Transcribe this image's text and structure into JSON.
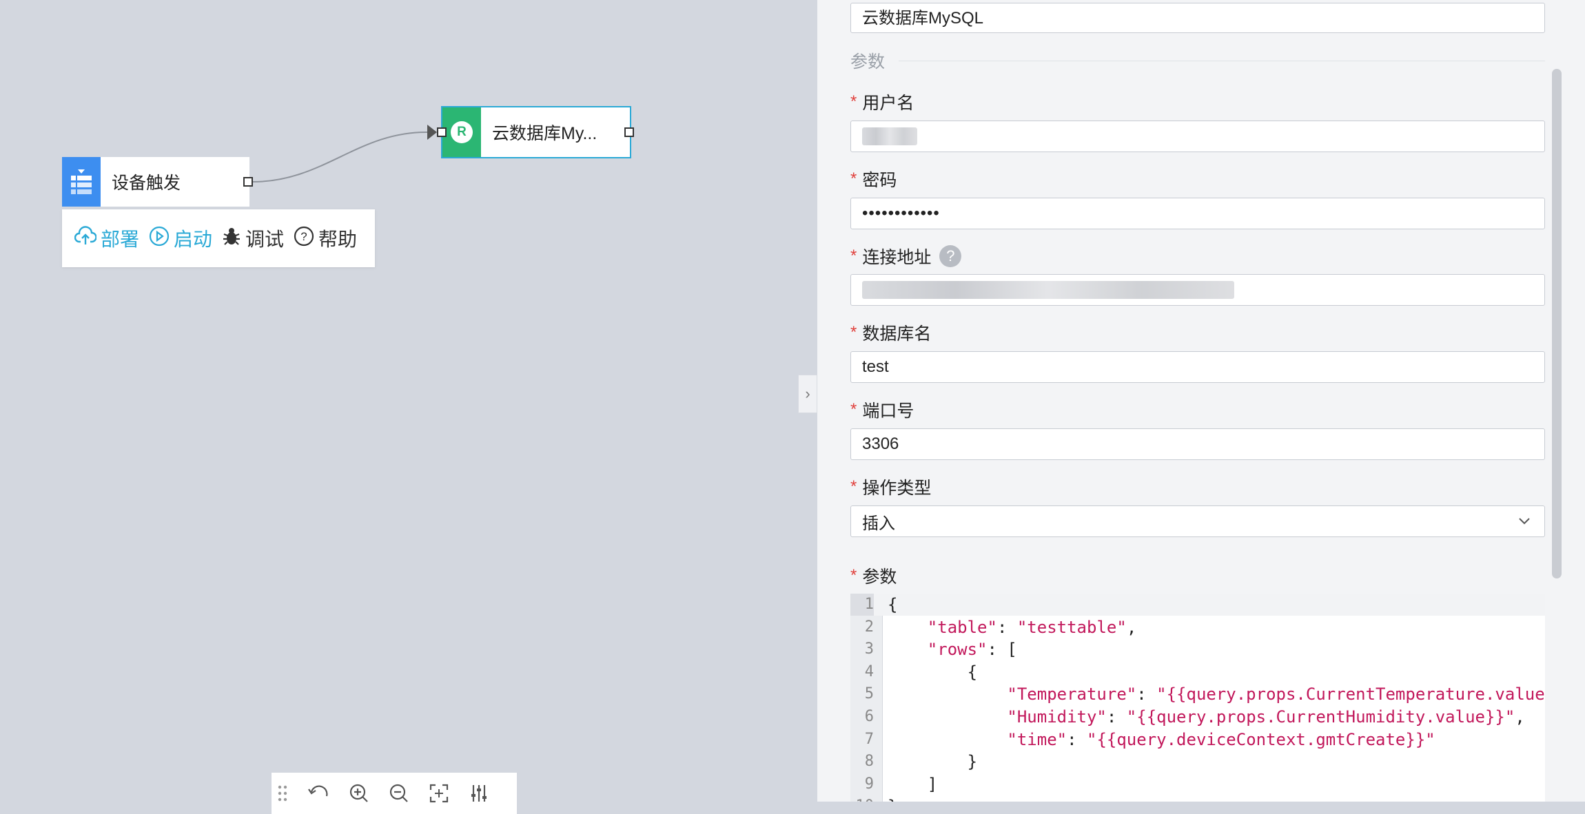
{
  "canvas": {
    "nodes": {
      "trigger": {
        "label": "设备触发",
        "icon": "device-trigger-icon",
        "color": "#3d8ef0"
      },
      "mysql": {
        "label": "云数据库My...",
        "badge": "R",
        "icon": "rds-icon",
        "color": "#2bb673"
      }
    },
    "toolbar": {
      "deploy": "部署",
      "start": "启动",
      "debug": "调试",
      "help": "帮助"
    },
    "zoom_tools": [
      "drag-handle-icon",
      "undo-icon",
      "zoom-in-icon",
      "zoom-out-icon",
      "fit-view-icon",
      "settings-sliders-icon"
    ],
    "collapse_glyph": "›"
  },
  "panel": {
    "node_name_value": "云数据库MySQL",
    "section_title": "参数",
    "fields": {
      "username": {
        "label": "用户名",
        "value": ""
      },
      "password": {
        "label": "密码",
        "value": "••••••••••••"
      },
      "host": {
        "label": "连接地址",
        "value": "",
        "help": "?"
      },
      "database": {
        "label": "数据库名",
        "value": "test"
      },
      "port": {
        "label": "端口号",
        "value": "3306"
      },
      "operation": {
        "label": "操作类型",
        "value": "插入"
      },
      "params": {
        "label": "参数"
      }
    },
    "editor": {
      "lines": [
        {
          "n": "1",
          "parts": [
            {
              "t": "{",
              "c": "p"
            }
          ]
        },
        {
          "n": "2",
          "parts": [
            {
              "t": "    ",
              "c": "p"
            },
            {
              "t": "\"table\"",
              "c": "s"
            },
            {
              "t": ": ",
              "c": "p"
            },
            {
              "t": "\"testtable\"",
              "c": "s"
            },
            {
              "t": ",",
              "c": "p"
            }
          ]
        },
        {
          "n": "3",
          "parts": [
            {
              "t": "    ",
              "c": "p"
            },
            {
              "t": "\"rows\"",
              "c": "s"
            },
            {
              "t": ": [",
              "c": "p"
            }
          ]
        },
        {
          "n": "4",
          "parts": [
            {
              "t": "        {",
              "c": "p"
            }
          ]
        },
        {
          "n": "5",
          "parts": [
            {
              "t": "            ",
              "c": "p"
            },
            {
              "t": "\"Temperature\"",
              "c": "s"
            },
            {
              "t": ": ",
              "c": "p"
            },
            {
              "t": "\"{{query.props.CurrentTemperature.value}}\"",
              "c": "s"
            },
            {
              "t": ",",
              "c": "p"
            }
          ]
        },
        {
          "n": "6",
          "parts": [
            {
              "t": "            ",
              "c": "p"
            },
            {
              "t": "\"Humidity\"",
              "c": "s"
            },
            {
              "t": ": ",
              "c": "p"
            },
            {
              "t": "\"{{query.props.CurrentHumidity.value}}\"",
              "c": "s"
            },
            {
              "t": ",",
              "c": "p"
            }
          ]
        },
        {
          "n": "7",
          "parts": [
            {
              "t": "            ",
              "c": "p"
            },
            {
              "t": "\"time\"",
              "c": "s"
            },
            {
              "t": ": ",
              "c": "p"
            },
            {
              "t": "\"{{query.deviceContext.gmtCreate}}\"",
              "c": "s"
            }
          ]
        },
        {
          "n": "8",
          "parts": [
            {
              "t": "        }",
              "c": "p"
            }
          ]
        },
        {
          "n": "9",
          "parts": [
            {
              "t": "    ]",
              "c": "p"
            }
          ]
        },
        {
          "n": "10",
          "parts": [
            {
              "t": "}",
              "c": "p"
            }
          ]
        }
      ]
    }
  },
  "colors": {
    "accent": "#2aa9d6",
    "required": "#e0403c",
    "string": "#c2185b"
  }
}
